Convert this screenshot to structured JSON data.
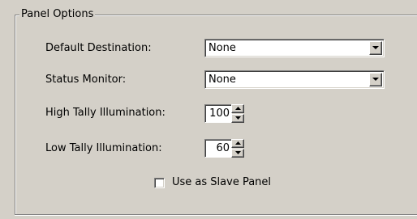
{
  "panel": {
    "title": "Panel Options",
    "default_destination": {
      "label": "Default Destination:",
      "value": "None"
    },
    "status_monitor": {
      "label": "Status Monitor:",
      "value": "None"
    },
    "high_tally": {
      "label": "High Tally Illumination:",
      "value": "100"
    },
    "low_tally": {
      "label": "Low Tally Illumination:",
      "value": "60"
    },
    "slave_panel": {
      "label": "Use as Slave Panel",
      "checked": false
    }
  },
  "icons": {
    "dropdown": "chevron-down-icon",
    "spin_up": "arrow-up-icon",
    "spin_down": "arrow-down-icon"
  },
  "colors": {
    "background": "#d4d0c8",
    "field": "#ffffff",
    "shadow": "#808080",
    "highlight": "#ffffff"
  }
}
